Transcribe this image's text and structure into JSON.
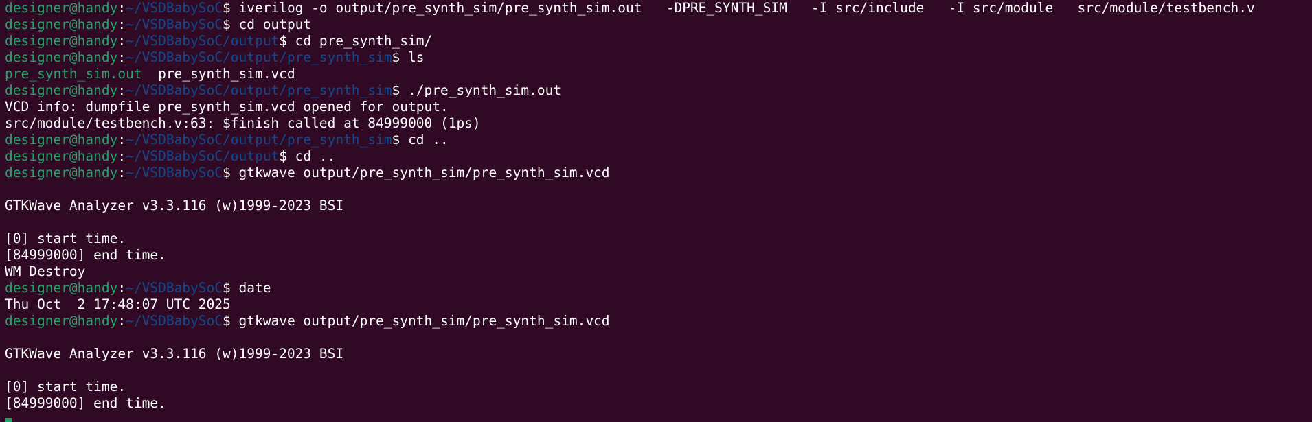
{
  "prompt": {
    "user_host": "designer@handy",
    "sep": ":",
    "end": "$ "
  },
  "colors": {
    "background": "#300a24",
    "user": "#26a269",
    "path": "#12488b",
    "text": "#ffffff"
  },
  "lines": [
    {
      "type": "prompt",
      "path": "~/VSDBabySoC",
      "cmd": "iverilog -o output/pre_synth_sim/pre_synth_sim.out   -DPRE_SYNTH_SIM   -I src/include   -I src/module   src/module/testbench.v"
    },
    {
      "type": "prompt",
      "path": "~/VSDBabySoC",
      "cmd": "cd output"
    },
    {
      "type": "prompt",
      "path": "~/VSDBabySoC/output",
      "cmd": "cd pre_synth_sim/"
    },
    {
      "type": "prompt",
      "path": "~/VSDBabySoC/output/pre_synth_sim",
      "cmd": "ls"
    },
    {
      "type": "ls",
      "items": [
        {
          "name": "pre_synth_sim.out",
          "kind": "exe"
        },
        {
          "name": "pre_synth_sim.vcd",
          "kind": "file"
        }
      ]
    },
    {
      "type": "prompt",
      "path": "~/VSDBabySoC/output/pre_synth_sim",
      "cmd": "./pre_synth_sim.out"
    },
    {
      "type": "output",
      "text": "VCD info: dumpfile pre_synth_sim.vcd opened for output."
    },
    {
      "type": "output",
      "text": "src/module/testbench.v:63: $finish called at 84999000 (1ps)"
    },
    {
      "type": "prompt",
      "path": "~/VSDBabySoC/output/pre_synth_sim",
      "cmd": "cd .."
    },
    {
      "type": "prompt",
      "path": "~/VSDBabySoC/output",
      "cmd": "cd .."
    },
    {
      "type": "prompt",
      "path": "~/VSDBabySoC",
      "cmd": "gtkwave output/pre_synth_sim/pre_synth_sim.vcd"
    },
    {
      "type": "output",
      "text": ""
    },
    {
      "type": "output",
      "text": "GTKWave Analyzer v3.3.116 (w)1999-2023 BSI"
    },
    {
      "type": "output",
      "text": ""
    },
    {
      "type": "output",
      "text": "[0] start time."
    },
    {
      "type": "output",
      "text": "[84999000] end time."
    },
    {
      "type": "output",
      "text": "WM Destroy"
    },
    {
      "type": "prompt",
      "path": "~/VSDBabySoC",
      "cmd": "date"
    },
    {
      "type": "output",
      "text": "Thu Oct  2 17:48:07 UTC 2025"
    },
    {
      "type": "prompt",
      "path": "~/VSDBabySoC",
      "cmd": "gtkwave output/pre_synth_sim/pre_synth_sim.vcd"
    },
    {
      "type": "output",
      "text": ""
    },
    {
      "type": "output",
      "text": "GTKWave Analyzer v3.3.116 (w)1999-2023 BSI"
    },
    {
      "type": "output",
      "text": ""
    },
    {
      "type": "output",
      "text": "[0] start time."
    },
    {
      "type": "output",
      "text": "[84999000] end time."
    }
  ]
}
